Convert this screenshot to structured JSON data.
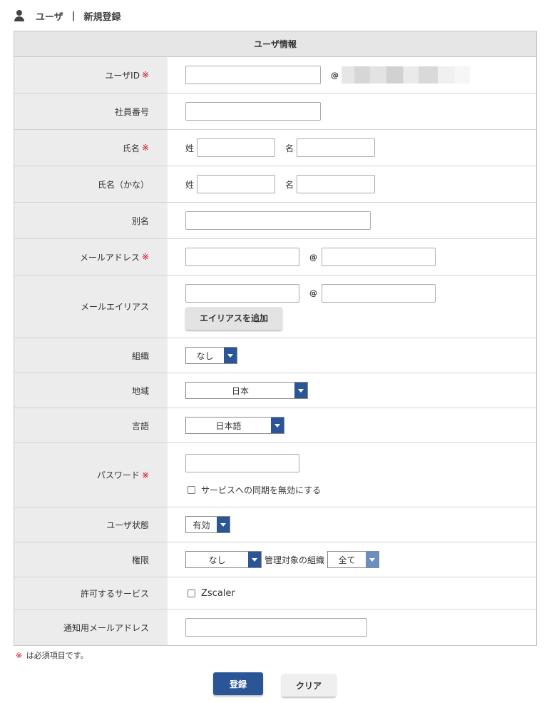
{
  "header": {
    "icon": "user-icon",
    "section": "ユーザ",
    "separator": "|",
    "title": "新規登録"
  },
  "form": {
    "heading": "ユーザ情報",
    "required_mark": "※",
    "user_id": {
      "label": "ユーザID",
      "value": "",
      "at": "@"
    },
    "employee_no": {
      "label": "社員番号",
      "value": ""
    },
    "name": {
      "label": "氏名",
      "last_prefix": "姓",
      "first_prefix": "名",
      "last": "",
      "first": ""
    },
    "name_kana": {
      "label": "氏名（かな）",
      "last_prefix": "姓",
      "first_prefix": "名",
      "last": "",
      "first": ""
    },
    "alias": {
      "label": "別名",
      "value": ""
    },
    "email": {
      "label": "メールアドレス",
      "at": "@",
      "local": "",
      "domain": ""
    },
    "email_alias": {
      "label": "メールエイリアス",
      "at": "@",
      "local": "",
      "domain": "",
      "add_button": "エイリアスを追加"
    },
    "organization": {
      "label": "組織",
      "selected": "なし"
    },
    "region": {
      "label": "地域",
      "selected": "日本"
    },
    "language": {
      "label": "言語",
      "selected": "日本語"
    },
    "password": {
      "label": "パスワード",
      "value": "",
      "sync_disable_label": "サービスへの同期を無効にする",
      "sync_disable_checked": false
    },
    "user_status": {
      "label": "ユーザ状態",
      "selected": "有効"
    },
    "permission": {
      "label": "権限",
      "selected": "なし",
      "managed_org_label": "管理対象の組織",
      "managed_org_selected": "全て"
    },
    "allowed_services": {
      "label": "許可するサービス",
      "service_name": "Zscaler",
      "checked": false
    },
    "notify_email": {
      "label": "通知用メールアドレス",
      "value": ""
    }
  },
  "footer": {
    "note_mark": "※",
    "note_text": "は必須項目です。",
    "register_button": "登録",
    "clear_button": "クリア"
  },
  "colors": {
    "accent": "#2a5597",
    "required": "#d0021b",
    "label_bg": "#ececec",
    "header_bg": "#e6e6e6"
  }
}
